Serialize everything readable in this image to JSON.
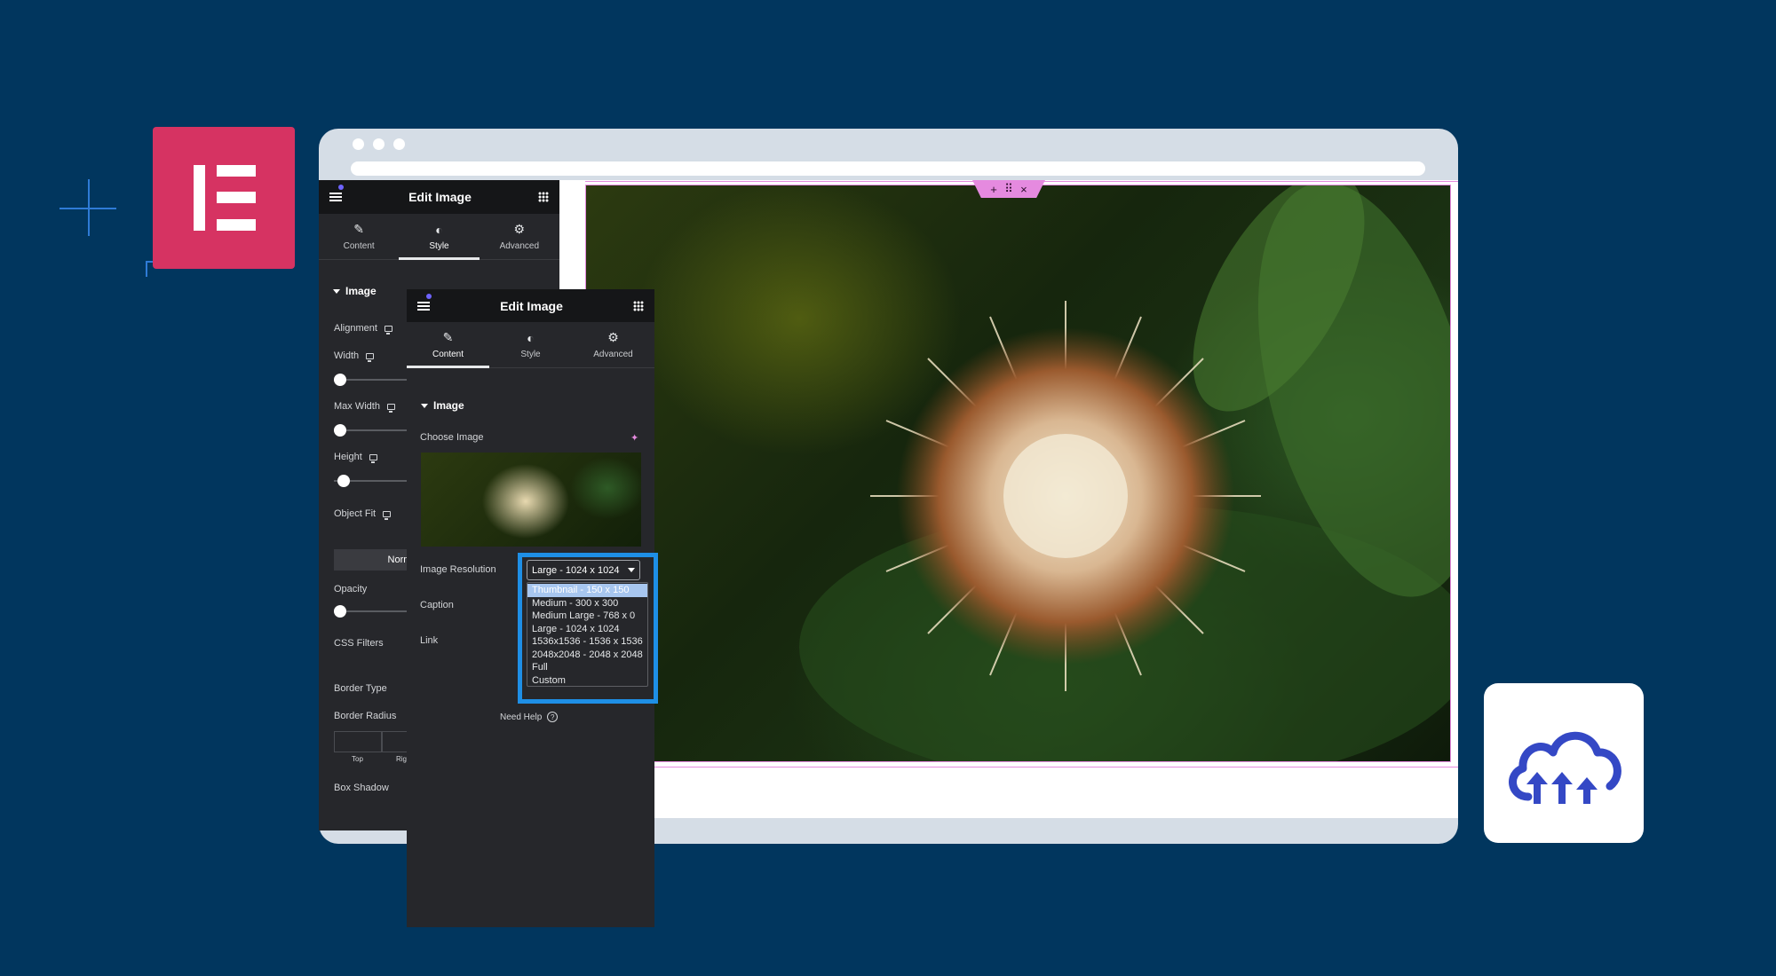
{
  "decorations": {
    "elementor_logo": "elementor-logo",
    "cloudinary_logo": "cloudinary-logo",
    "accent_colors": {
      "background": "#01365e",
      "elementor": "#d63362",
      "highlight": "#1e8fe6",
      "canvas_outline": "#e58adf"
    }
  },
  "canvas": {
    "handle_icons": [
      "+",
      "⠿",
      "×"
    ]
  },
  "back_panel": {
    "title": "Edit Image",
    "tabs": [
      {
        "label": "Content",
        "icon": "pencil-icon"
      },
      {
        "label": "Style",
        "icon": "contrast-icon",
        "active": true
      },
      {
        "label": "Advanced",
        "icon": "gear-icon"
      }
    ],
    "section": "Image",
    "controls": {
      "alignment": "Alignment",
      "width": "Width",
      "max_width": "Max Width",
      "height": "Height",
      "object_fit": "Object Fit",
      "normal": "Normal",
      "opacity": "Opacity",
      "css_filters": "CSS Filters",
      "border_type": "Border Type",
      "border_radius": "Border Radius",
      "top": "Top",
      "right": "Rig",
      "box_shadow": "Box Shadow"
    }
  },
  "front_panel": {
    "title": "Edit Image",
    "tabs": [
      {
        "label": "Content",
        "icon": "pencil-icon",
        "active": true
      },
      {
        "label": "Style",
        "icon": "contrast-icon"
      },
      {
        "label": "Advanced",
        "icon": "gear-icon"
      }
    ],
    "section": "Image",
    "choose_image": "Choose Image",
    "image_resolution": "Image Resolution",
    "resolution_value": "Large - 1024 x 1024",
    "caption": "Caption",
    "link": "Link",
    "need_help": "Need Help",
    "resolution_options": [
      "Thumbnail - 150 x 150",
      "Medium - 300 x 300",
      "Medium Large - 768 x 0",
      "Large - 1024 x 1024",
      "1536x1536 - 1536 x 1536",
      "2048x2048 - 2048 x 2048",
      "Full",
      "Custom"
    ]
  }
}
